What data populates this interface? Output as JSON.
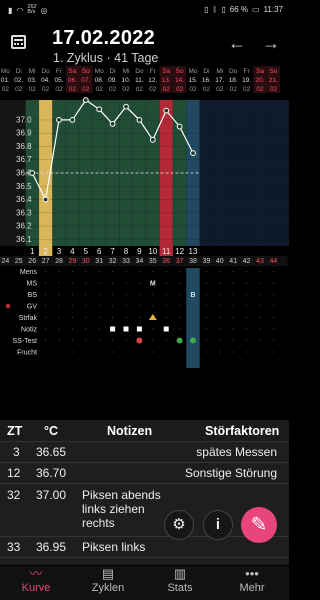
{
  "status_bar": {
    "speed": "262\nB/s",
    "battery": "66 %",
    "time": "11:37"
  },
  "header": {
    "date": "17.02.2022",
    "subtitle": "1. Zyklus · 41 Tage"
  },
  "calendar": {
    "weekdays": [
      "Mo",
      "Di",
      "Mi",
      "Do",
      "Fr",
      "Sa",
      "So",
      "Mo",
      "Di",
      "Mi",
      "Do",
      "Fr",
      "Sa",
      "So",
      "Mo",
      "Di",
      "Mi",
      "Do",
      "Fr",
      "Sa",
      "So"
    ],
    "dates": [
      "01.",
      "02.",
      "03.",
      "04.",
      "05.",
      "06.",
      "07.",
      "08.",
      "09.",
      "10.",
      "11.",
      "12.",
      "13.",
      "14.",
      "15.",
      "16.",
      "17.",
      "18.",
      "19.",
      "20.",
      "21."
    ],
    "months": [
      "02",
      "02",
      "02",
      "02",
      "02",
      "02",
      "02",
      "02",
      "02",
      "02",
      "02",
      "02",
      "02",
      "02",
      "02",
      "02",
      "02",
      "02",
      "02",
      "02",
      "02"
    ]
  },
  "chart_data": {
    "type": "line",
    "title": "",
    "y_ticks": [
      "37.0",
      "36.9",
      "36.8",
      "36.7",
      "36.6",
      "36.5",
      "36.4",
      "36.3",
      "36.2",
      "36.1"
    ],
    "ylim": [
      36.05,
      37.15
    ],
    "coverline": 36.6,
    "x_labels": [
      "1",
      "2",
      "3",
      "4",
      "5",
      "6",
      "7",
      "8",
      "9",
      "10",
      "11",
      "12",
      "13"
    ],
    "series": [
      {
        "values": [
          36.6,
          36.4,
          37.0,
          37.0,
          37.15,
          37.08,
          36.97,
          37.1,
          37.0,
          36.85,
          37.07,
          36.95,
          36.75
        ]
      }
    ],
    "ovulation_day": 2,
    "period_day": 11,
    "zt_labels": [
      "24",
      "25",
      "26",
      "27",
      "28",
      "29",
      "30",
      "31",
      "32",
      "33",
      "34",
      "35",
      "36",
      "37",
      "38",
      "39",
      "40",
      "41",
      "42",
      "43",
      "44"
    ]
  },
  "symptom_rows": [
    "Mens",
    "MS",
    "BS",
    "GV",
    "Strfak",
    "Notiz",
    "SS-Test",
    "Frucht"
  ],
  "symptom_marks": {
    "ms": "M",
    "bs": "B"
  },
  "table": {
    "headers": {
      "zt": "ZT",
      "temp": "°C",
      "notes": "Notizen",
      "factors": "Störfaktoren"
    },
    "rows": [
      {
        "zt": "3",
        "temp": "36.65",
        "notes": "",
        "factors": "spätes Messen"
      },
      {
        "zt": "12",
        "temp": "36.70",
        "notes": "",
        "factors": "Sonstige Störung"
      },
      {
        "zt": "32",
        "temp": "37.00",
        "notes": "Piksen abends links ziehen rechts",
        "factors": ""
      },
      {
        "zt": "33",
        "temp": "36.95",
        "notes": "Piksen links",
        "factors": ""
      }
    ]
  },
  "fabs": {
    "settings_icon": "gear-icon",
    "info_label": "i",
    "edit_icon": "pencil-icon"
  },
  "nav": {
    "items": [
      "Kurve",
      "Zyklen",
      "Stats",
      "Mehr"
    ],
    "active": "Kurve"
  },
  "colors": {
    "accent": "#e8457f",
    "fertile_green": "#214d36",
    "period_red": "#b22a38",
    "ovulation_yellow": "#d9b659",
    "weekend_red": "#ff4d5e"
  }
}
